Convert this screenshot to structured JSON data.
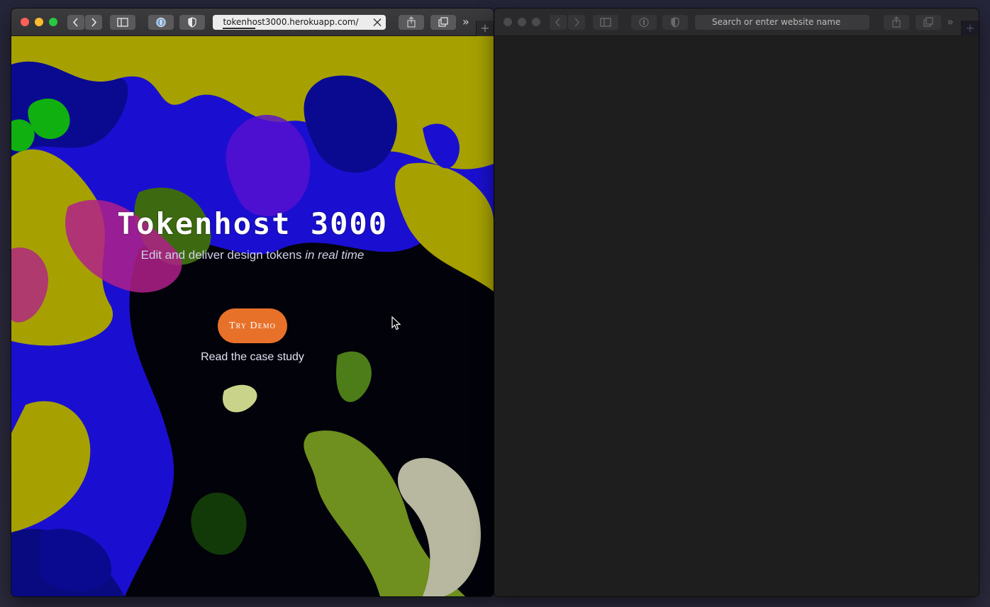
{
  "colors": {
    "cta_background": "#e8712a",
    "close": "#ff5f57",
    "minimize": "#febc2e",
    "maximize": "#28c840"
  },
  "left_window": {
    "toolbar": {
      "url": "tokenhost3000.herokuapp.com/",
      "icons": [
        "back-icon",
        "forward-icon",
        "sidebar-icon",
        "password-manager-icon",
        "privacy-shield-icon",
        "close-icon",
        "share-icon",
        "tabs-icon",
        "overflow-chevron-icon",
        "new-tab-icon"
      ],
      "new_tab_label": "+",
      "overflow_label": "»"
    },
    "page": {
      "title": "Tokenhost 3000",
      "subtitle_plain": "Edit and deliver design tokens ",
      "subtitle_emphasis": "in real time",
      "cta_label": "Try Demo",
      "case_study_link": "Read the case study"
    }
  },
  "right_window": {
    "toolbar": {
      "address_placeholder": "Search or enter website name",
      "new_tab_label": "+",
      "overflow_label": "»"
    }
  }
}
